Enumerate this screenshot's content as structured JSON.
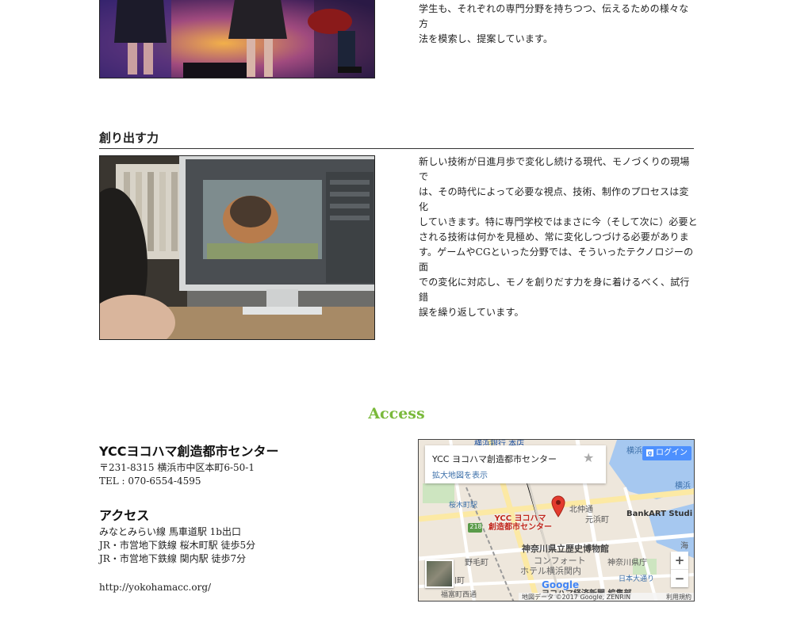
{
  "section1": {
    "text_lines": [
      "学生も、それぞれの専門分野を持ちつつ、伝えるための様々な方",
      "法を模索し、提案しています。"
    ]
  },
  "section2": {
    "title": "創り出す力",
    "text_lines": [
      "新しい技術が日進月歩で変化し続ける現代、モノづくりの現場で",
      "は、その時代によって必要な視点、技術、制作のプロセスは変化",
      "していきます。特に専門学校ではまさに今（そして次に）必要と",
      "される技術は何かを見極め、常に変化しつづける必要がありま",
      "す。ゲームやCGといった分野では、そういったテクノロジーの面",
      "での変化に対応し、モノを創りだす力を身に着けるべく、試行錯",
      "誤を繰り返しています。"
    ]
  },
  "access": {
    "title": "Access",
    "venue_name": "YCCヨコハマ創造都市センター",
    "postal_address": "〒231-8315 横浜市中区本町6-50-1",
    "tel": "TEL : 070-6554-4595",
    "access_heading": "アクセス",
    "routes": [
      "みなとみらい線 馬車道駅 1b出口",
      "JR・市営地下鉄線 桜木町駅 徒歩5分",
      "JR・市営地下鉄線 関内駅 徒歩7分"
    ],
    "url": "http://yokohamacc.org/"
  },
  "map": {
    "card_title": "YCC ヨコハマ創造都市センター",
    "card_link": "拡大地図を表示",
    "login_label": "ログイン",
    "pin_label_line1": "YCC ヨコハマ",
    "pin_label_line2": "創造都市センター",
    "labels": {
      "bank_top": "横浜銀行 本店",
      "yokohama_wa": "横浜ワー",
      "yokohama_right": "横浜",
      "sakuragicho": "桜木町駅",
      "kitanaka": "北仲通",
      "motomachi": "元浜町",
      "bankart": "BankART Studi",
      "museum": "神奈川県立歴史博物館",
      "nogemachi": "野毛町",
      "prefecture": "神奈川県庁",
      "conforto": "コンフォート",
      "hotel": "ホテル横浜関内",
      "nihon_odori": "日本大通り",
      "kaigan": "海岸",
      "hashikawa": "川町",
      "fukutomi": "福富町西通",
      "shinbun": "ヨコハマ経済新聞 編集部",
      "route_num": "218",
      "copyright": "地図データ ©2017 Google, ZENRIN",
      "terms": "利用規約",
      "google": "Google"
    },
    "zoom_in": "+",
    "zoom_out": "−"
  }
}
